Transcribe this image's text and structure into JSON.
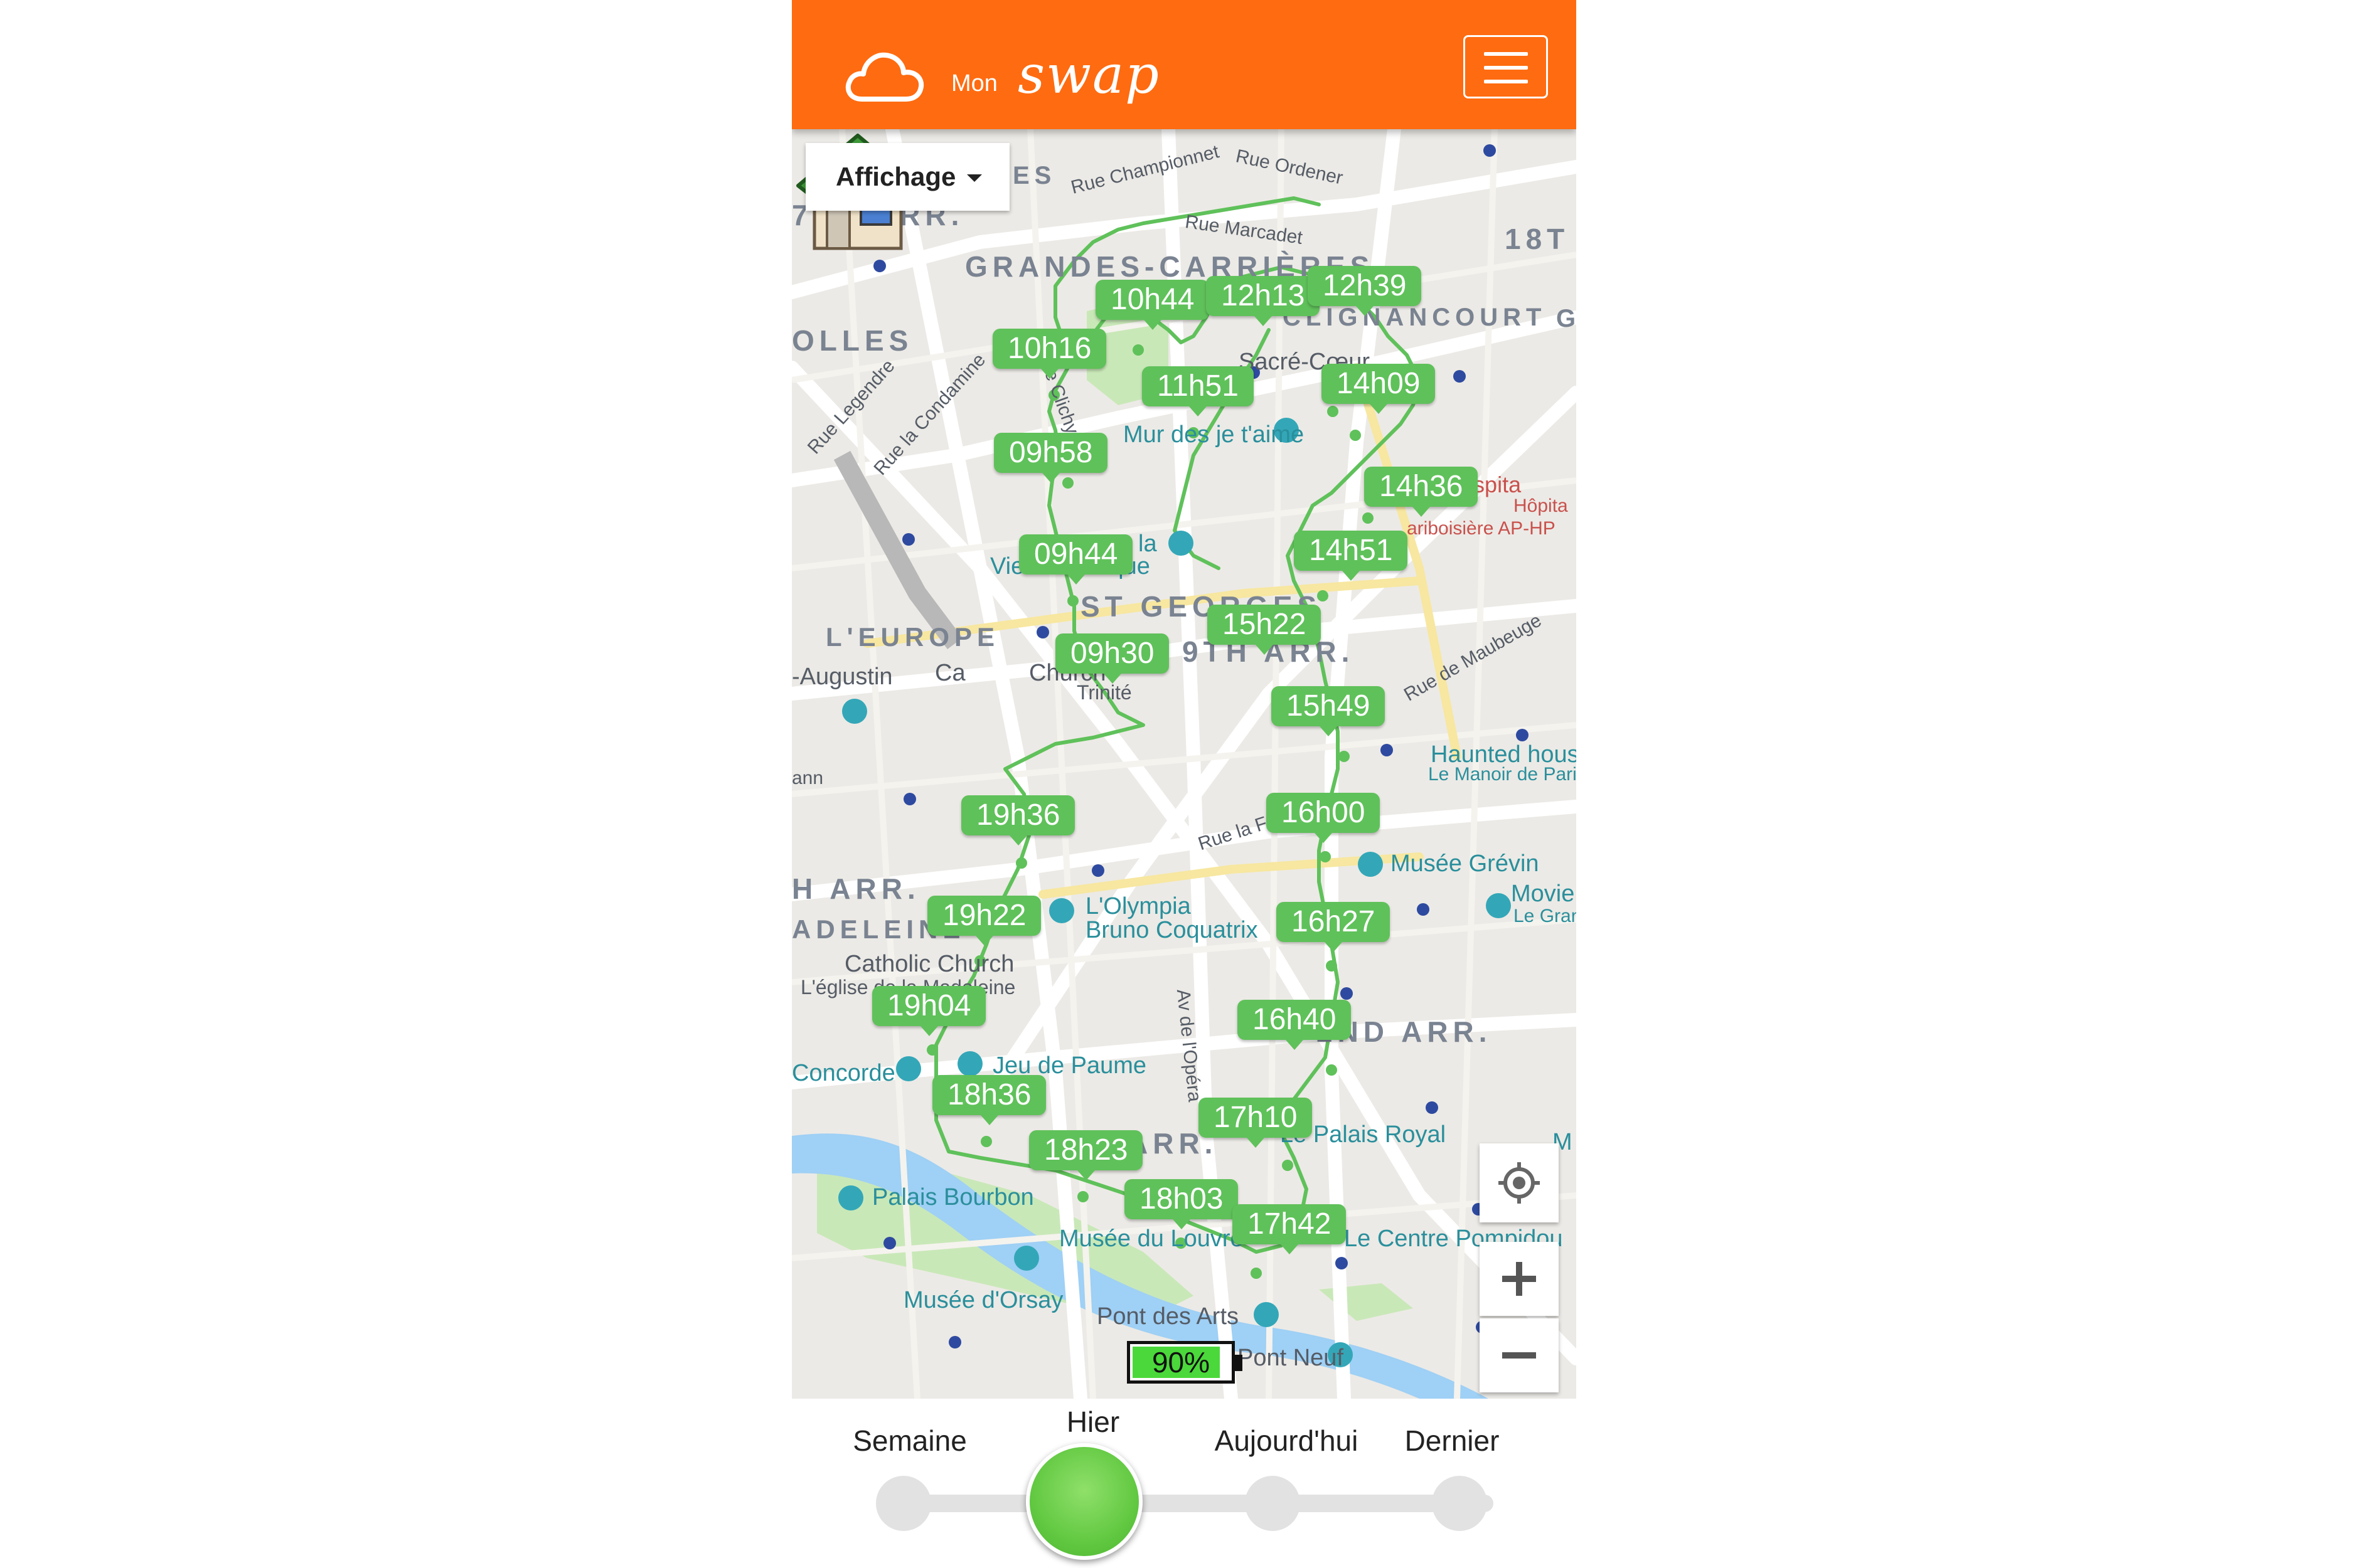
{
  "header": {
    "brand_prefix": "Mon",
    "brand_name": "swap",
    "accent_color": "#ff6b10"
  },
  "map": {
    "display_button": "Affichage",
    "districts": [
      "7TH ARR.",
      "GRANDES-CARRIÈRES",
      "18T",
      "CLIGNANCOURT",
      "OLLES",
      "L'EUROPE",
      "ST GEORGES",
      "9TH ARR.",
      "H ARR.",
      "ADELEINE",
      "2ND ARR.",
      "ARR."
    ],
    "streets": [
      "Rue Championnet",
      "Rue Ordener",
      "Rue Marcadet",
      "Rue Legendre",
      "Rue la Condamine",
      "Av de Clichy",
      "Rue de Maubeuge",
      "Rue la Fayette",
      "Av de l'Opéra",
      "ES"
    ],
    "places": [
      "Sacré-Cœur",
      "Mur des je t'aime",
      "Vie romantique",
      "Haunted house",
      "Le Manoir de Paris",
      "Musée Grévin",
      "L'Olympia",
      "Bruno Coquatrix",
      "Movie",
      "Le Gran",
      "Catholic Church",
      "L'église de la Madeleine",
      "Jeu de Paume",
      "Concorde",
      "Le Palais Royal",
      "Palais Bourbon",
      "Musée du Louvre",
      "Le Centre Pompidou",
      "Musée d'Orsay",
      "Pont des Arts",
      "Pont Neuf",
      "-Augustin",
      "Trinité",
      "Church",
      "Ca",
      "ann",
      "la",
      "M",
      "G",
      "l hospita",
      "Hôpita",
      "ariboisière AP-HP"
    ],
    "time_markers": [
      "10h44",
      "12h13",
      "12h39",
      "10h16",
      "11h51",
      "14h09",
      "09h58",
      "14h36",
      "09h44",
      "14h51",
      "15h22",
      "09h30",
      "15h49",
      "19h36",
      "16h00",
      "16h27",
      "19h22",
      "19h04",
      "16h40",
      "18h36",
      "17h10",
      "18h23",
      "18h03",
      "17h42"
    ],
    "route_color": "#5fc15a"
  },
  "battery": {
    "label": "90%",
    "level": 0.9
  },
  "timeline": {
    "options": [
      "Semaine",
      "Hier",
      "Aujourd'hui",
      "Dernier"
    ],
    "selected": "Hier"
  }
}
